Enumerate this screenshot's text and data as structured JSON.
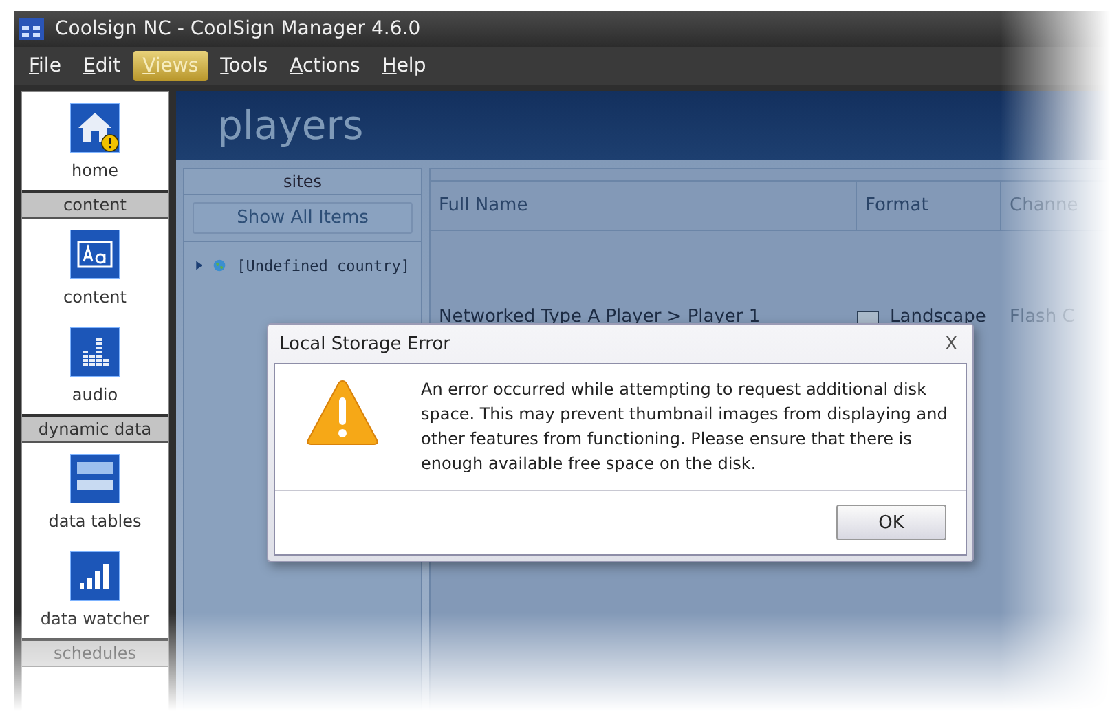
{
  "window": {
    "title": "Coolsign NC - CoolSign Manager 4.6.0"
  },
  "menu": [
    {
      "label": "File",
      "selected": false
    },
    {
      "label": "Edit",
      "selected": false
    },
    {
      "label": "Views",
      "selected": true
    },
    {
      "label": "Tools",
      "selected": false
    },
    {
      "label": "Actions",
      "selected": false
    },
    {
      "label": "Help",
      "selected": false
    }
  ],
  "sidebar": {
    "items": [
      {
        "kind": "item",
        "label": "home"
      },
      {
        "kind": "header",
        "label": "content"
      },
      {
        "kind": "item",
        "label": "content"
      },
      {
        "kind": "item",
        "label": "audio"
      },
      {
        "kind": "header",
        "label": "dynamic data"
      },
      {
        "kind": "item",
        "label": "data tables"
      },
      {
        "kind": "item",
        "label": "data watcher"
      },
      {
        "kind": "header",
        "label": "schedules"
      }
    ]
  },
  "page": {
    "title": "players"
  },
  "sites": {
    "title": "sites",
    "button": "Show All Items",
    "tree": [
      {
        "label": "[Undefined country]",
        "expanded": false
      }
    ]
  },
  "table": {
    "columns": [
      "Full Name",
      "Format",
      "Channe"
    ],
    "rows": [
      {
        "full_name": "Networked Type A Player > Player 1",
        "format": "Landscape",
        "column_3": "Flash C"
      }
    ]
  },
  "dialog": {
    "title": "Local Storage Error",
    "close": "X",
    "message": "An error occurred while attempting to request additional disk space. This may prevent thumbnail images from displaying and other features from functioning. Please ensure that there is enough available free space on the disk.",
    "button": "OK"
  }
}
